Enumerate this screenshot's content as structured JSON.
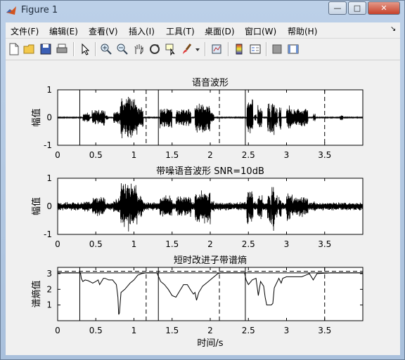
{
  "window": {
    "title": "Figure 1",
    "min": "—",
    "max": "□",
    "close": "✕"
  },
  "menu": [
    "文件(F)",
    "编辑(E)",
    "查看(V)",
    "插入(I)",
    "工具(T)",
    "桌面(D)",
    "窗口(W)",
    "帮助(H)"
  ],
  "menu_overflow": "↘",
  "toolbar_icons": [
    "new-figure-icon",
    "open-file-icon",
    "save-icon",
    "print-icon",
    "pointer-icon",
    "zoom-in-icon",
    "zoom-out-icon",
    "pan-icon",
    "rotate-3d-icon",
    "data-cursor-icon",
    "brush-icon",
    "brush-dropdown-icon",
    "link-plot-icon",
    "colorbar-icon",
    "legend-icon",
    "hide-plot-tools-icon",
    "show-plot-tools-icon"
  ],
  "chart_data": [
    {
      "type": "line",
      "title": "语音波形",
      "ylabel": "幅值",
      "xlim": [
        0,
        4
      ],
      "ylim": [
        -1,
        1
      ],
      "x_ticks": [
        "0",
        "0.5",
        "1",
        "1.5",
        "2",
        "2.5",
        "3",
        "3.5"
      ],
      "y_ticks": [
        "1",
        "0",
        "-1"
      ],
      "segment_start_lines": [
        0.29,
        1.32,
        2.46
      ],
      "segment_end_lines": [
        1.16,
        2.12,
        3.5
      ],
      "series": [
        {
          "values_description_free": true,
          "envelope": [
            [
              0.33,
              0.42,
              0.18
            ],
            [
              0.45,
              0.62,
              0.3
            ],
            [
              0.63,
              0.66,
              0.1
            ],
            [
              0.73,
              0.82,
              0.25
            ],
            [
              0.82,
              1.04,
              0.85
            ],
            [
              1.04,
              1.12,
              0.4
            ],
            [
              1.34,
              1.5,
              0.4
            ],
            [
              1.55,
              1.75,
              0.35
            ],
            [
              1.8,
              2.0,
              0.6
            ],
            [
              2.0,
              2.05,
              0.2
            ],
            [
              2.48,
              2.56,
              0.7
            ],
            [
              2.58,
              2.6,
              0.2
            ],
            [
              2.62,
              2.68,
              0.45
            ],
            [
              2.75,
              2.79,
              0.55
            ],
            [
              2.8,
              2.84,
              0.85
            ],
            [
              2.84,
              2.88,
              0.45
            ],
            [
              2.9,
              2.93,
              0.45
            ],
            [
              3.0,
              3.05,
              0.5
            ],
            [
              3.05,
              3.28,
              0.35
            ],
            [
              3.35,
              3.38,
              0.15
            ],
            [
              3.7,
              3.74,
              0.1
            ]
          ]
        }
      ]
    },
    {
      "type": "line",
      "title": "带噪语音波形 SNR=10dB",
      "ylabel": "幅值",
      "xlim": [
        0,
        4
      ],
      "ylim": [
        -1,
        1
      ],
      "x_ticks": [
        "0",
        "0.5",
        "1",
        "1.5",
        "2",
        "2.5",
        "3",
        "3.5"
      ],
      "y_ticks": [
        "1",
        "0",
        "-1"
      ],
      "noise_amplitude": 0.08,
      "series": [
        {
          "name": "",
          "note": ""
        }
      ]
    },
    {
      "type": "line",
      "title": "短时改进子带谱熵",
      "ylabel": "谱熵值",
      "xlabel": "时间/s",
      "xlim": [
        0,
        4
      ],
      "ylim": [
        0,
        3.4
      ],
      "x_ticks": [
        "0",
        "0.5",
        "1",
        "1.5",
        "2",
        "2.5",
        "3",
        "3.5"
      ],
      "y_ticks": [
        "3",
        "2",
        "1"
      ],
      "threshold_levels": [
        3.15,
        3.05
      ],
      "segment_start_lines": [
        0.29,
        1.32,
        2.46
      ],
      "segment_end_lines": [
        1.16,
        2.12,
        3.5
      ],
      "series": [
        {
          "x": [
            0,
            0.3,
            0.31,
            0.33,
            0.36,
            0.4,
            0.46,
            0.5,
            0.53,
            0.55,
            0.6,
            0.62,
            0.67,
            0.72,
            0.77,
            0.79,
            0.8,
            0.81,
            0.83,
            0.88,
            0.95,
            1.0,
            1.05,
            1.1,
            1.16,
            1.2,
            1.3,
            1.35,
            1.4,
            1.45,
            1.5,
            1.55,
            1.6,
            1.65,
            1.7,
            1.75,
            1.78,
            1.8,
            1.82,
            1.85,
            1.9,
            1.95,
            2.0,
            2.05,
            2.1,
            2.15,
            2.3,
            2.45,
            2.47,
            2.5,
            2.55,
            2.6,
            2.63,
            2.66,
            2.7,
            2.72,
            2.74,
            2.77,
            2.8,
            2.82,
            2.84,
            2.9,
            2.93,
            2.95,
            3.0,
            3.05,
            3.1,
            3.2,
            3.25,
            3.3,
            3.35,
            3.4,
            3.6,
            4.0
          ],
          "y": [
            3.05,
            3.05,
            2.7,
            2.5,
            2.6,
            2.55,
            2.4,
            2.5,
            2.6,
            2.3,
            2.7,
            2.7,
            2.6,
            2.6,
            2.3,
            1.5,
            0.4,
            0.5,
            1.8,
            2.0,
            2.4,
            2.6,
            2.9,
            3.0,
            3.05,
            3.05,
            3.05,
            2.5,
            2.3,
            2.0,
            1.6,
            1.5,
            1.9,
            2.3,
            2.3,
            1.9,
            1.7,
            1.8,
            1.3,
            1.8,
            2.2,
            2.4,
            2.6,
            2.8,
            3.0,
            3.05,
            3.05,
            3.05,
            2.6,
            2.3,
            2.6,
            2.7,
            1.6,
            2.5,
            2.2,
            1.5,
            1.0,
            1.0,
            1.0,
            1.1,
            2.1,
            2.7,
            2.4,
            2.7,
            2.8,
            2.8,
            2.8,
            2.8,
            2.9,
            3.0,
            2.6,
            3.0,
            3.05,
            3.05
          ]
        }
      ]
    }
  ]
}
